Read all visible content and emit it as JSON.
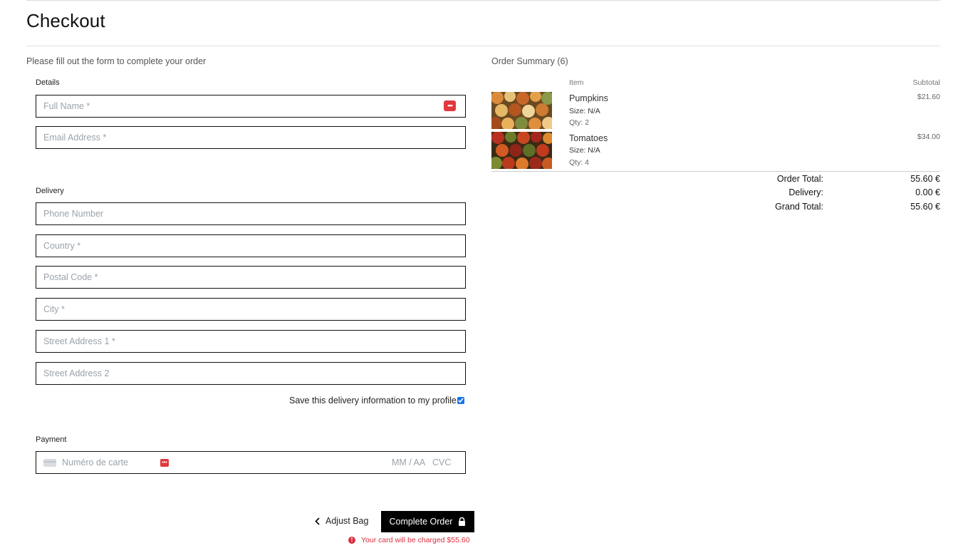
{
  "page": {
    "title": "Checkout",
    "intro": "Please fill out the form to complete your order"
  },
  "details": {
    "label": "Details",
    "full_name_placeholder": "Full Name *",
    "email_placeholder": "Email Address *"
  },
  "delivery": {
    "label": "Delivery",
    "phone_placeholder": "Phone Number",
    "country_placeholder": "Country *",
    "postal_placeholder": "Postal Code *",
    "city_placeholder": "City *",
    "street1_placeholder": "Street Address 1 *",
    "street2_placeholder": "Street Address 2",
    "save_label": "Save this delivery information to my profile",
    "save_checked": true
  },
  "payment": {
    "label": "Payment",
    "card_placeholder": "Numéro de carte",
    "exp_placeholder": "MM / AA",
    "cvc_placeholder": "CVC"
  },
  "actions": {
    "adjust_bag": "Adjust Bag",
    "complete_order": "Complete Order",
    "charge_note": "Your card will be charged $55.60"
  },
  "summary": {
    "title": "Order Summary (6)",
    "col_item": "Item",
    "col_subtotal": "Subtotal",
    "items": [
      {
        "name": "Pumpkins",
        "size": "Size: N/A",
        "qty": "Qty: 2",
        "price": "$21.60"
      },
      {
        "name": "Tomatoes",
        "size": "Size: N/A",
        "qty": "Qty: 4",
        "price": "$34.00"
      }
    ],
    "order_total_label": "Order Total:",
    "order_total": "55.60 €",
    "delivery_label": "Delivery:",
    "delivery_value": "0.00 €",
    "grand_total_label": "Grand Total:",
    "grand_total": "55.60 €"
  },
  "colors": {
    "accent_error": "#d93040",
    "button_bg": "#000000",
    "password_manager_icon": "#e0393e"
  },
  "icons": [
    "password-manager-icon",
    "card-icon",
    "chevron-left-icon",
    "lock-icon",
    "alert-icon"
  ]
}
